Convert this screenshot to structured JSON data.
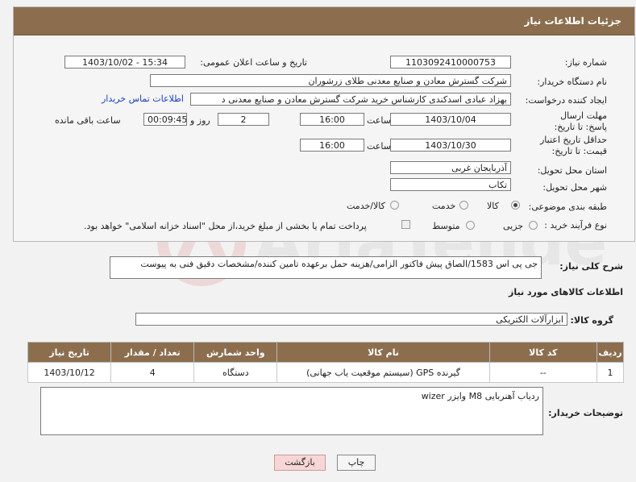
{
  "header": {
    "title": "جزئیات اطلاعات نیاز"
  },
  "fields": {
    "need_number_label": "شماره نیاز:",
    "need_number": "1103092410000753",
    "announce_label": "تاریخ و ساعت اعلان عمومی:",
    "announce_value": "1403/10/02 - 15:34",
    "buyer_org_label": "نام دستگاه خریدار:",
    "buyer_org": "شرکت گسترش معادن و صنایع معدنی طلای زرشوران",
    "creator_label": "ایجاد کننده درخواست:",
    "creator": "بهزاد عبادی اسدکندی کارشناس خرید  شرکت گسترش معادن و صنایع معدنی د",
    "contact_link": "اطلاعات تماس خریدار",
    "reply_deadline_label": "مهلت ارسال پاسخ: تا تاریخ:",
    "reply_date": "1403/10/04",
    "time_label": "ساعت",
    "reply_time": "16:00",
    "days_value": "2",
    "days_label": "روز و",
    "remaining_time": "00:09:45",
    "remaining_label": "ساعت باقی مانده",
    "price_valid_label": "حداقل تاریخ اعتبار قیمت: تا تاریخ:",
    "price_date": "1403/10/30",
    "price_time": "16:00",
    "province_label": "استان محل تحویل:",
    "province": "آذربایجان غربی",
    "city_label": "شهر محل تحویل:",
    "city": "تکاب",
    "category_label": "طبقه بندی موضوعی:",
    "category_options": [
      "کالا",
      "خدمت",
      "کالا/خدمت"
    ],
    "purchase_type_label": "نوع فرآیند خرید :",
    "purchase_options": [
      "جزیی",
      "متوسط"
    ],
    "payment_note": "پرداخت تمام یا بخشی از مبلغ خرید،از محل \"اسناد خزانه اسلامی\" خواهد بود."
  },
  "description": {
    "label": "شرح کلی نیاز:",
    "text": "جی پی اس 1583/الصاق پیش فاکتور الزامی/هزینه حمل برعهده تامین کننده/مشخصات دقیق فنی به پیوست"
  },
  "goods_info_title": "اطلاعات کالاهای مورد نیاز",
  "goods_group_label": "گروه کالا:",
  "goods_group": "ابزارآلات الکتریکی",
  "table": {
    "headers": [
      "ردیف",
      "کد کالا",
      "نام کالا",
      "واحد شمارش",
      "تعداد / مقدار",
      "تاریخ نیاز"
    ],
    "rows": [
      [
        "1",
        "--",
        "گیرنده GPS (سیستم موقعیت یاب جهانی)",
        "دستگاه",
        "4",
        "1403/10/12"
      ]
    ]
  },
  "buyer_notes": {
    "label": "توضیحات خریدار:",
    "text": "ردیاب آهنربایی M8 وایزر wizer"
  },
  "buttons": {
    "print": "چاپ",
    "back": "بازگشت"
  }
}
